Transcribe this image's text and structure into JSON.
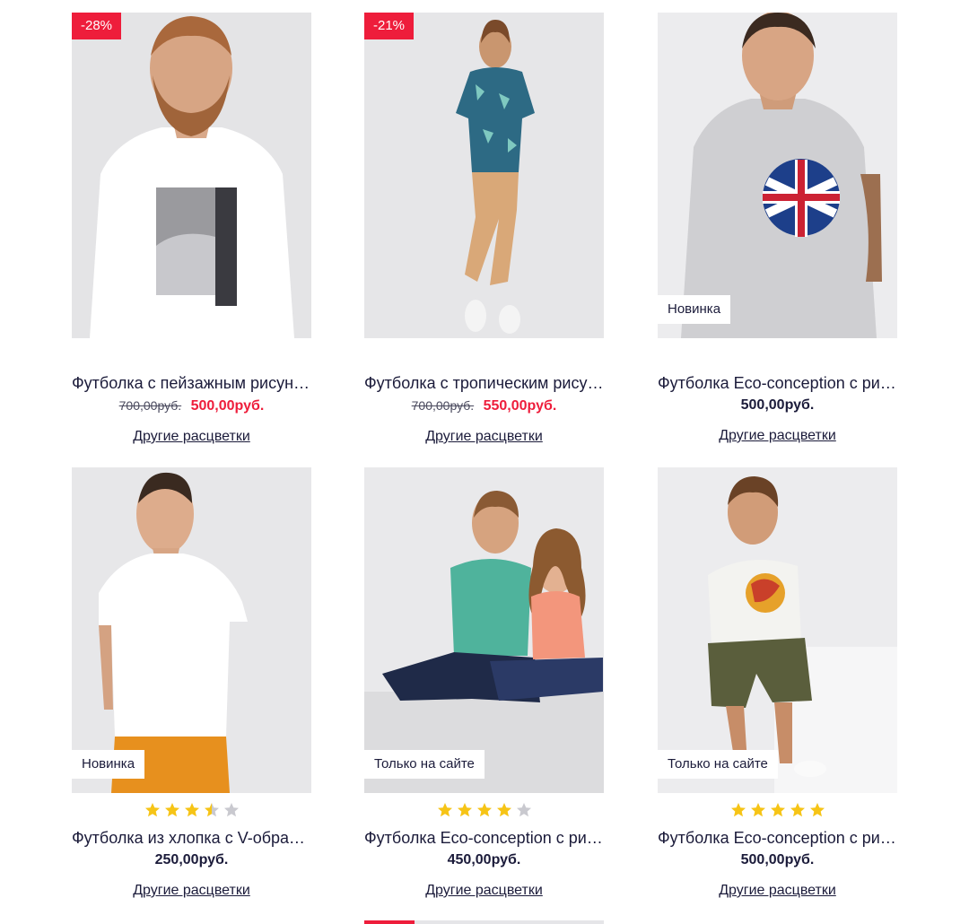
{
  "products": [
    {
      "badge_discount": "-28%",
      "title": "Футболка с пейзажным рисунком",
      "price_old": "700,00руб.",
      "price_sale": "500,00руб.",
      "colors_link": "Другие расцветки"
    },
    {
      "badge_discount": "-21%",
      "title": "Футболка с тропическим рисунком",
      "price_old": "700,00руб.",
      "price_sale": "550,00руб.",
      "colors_link": "Другие расцветки"
    },
    {
      "badge_tag": "Новинка",
      "title": "Футболка Eco-conception с рисунком",
      "price": "500,00руб.",
      "colors_link": "Другие расцветки"
    },
    {
      "badge_tag": "Новинка",
      "rating": 3.5,
      "title": "Футболка из хлопка с V-образным вырезом",
      "price": "250,00руб.",
      "colors_link": "Другие расцветки"
    },
    {
      "badge_tag": "Только на сайте",
      "rating": 4,
      "title": "Футболка Eco-conception с рисунком",
      "price": "450,00руб.",
      "colors_link": "Другие расцветки"
    },
    {
      "badge_tag": "Только на сайте",
      "rating": 5,
      "title": "Футболка Eco-conception с рисунком",
      "price": "500,00руб.",
      "colors_link": "Другие расцветки"
    }
  ],
  "colors": {
    "sale": "#ee1d3b",
    "text": "#1b1b3a",
    "star_filled": "#f6c416",
    "star_empty": "#c9c9cf"
  },
  "pagination": {
    "current": 1,
    "total": 5
  }
}
